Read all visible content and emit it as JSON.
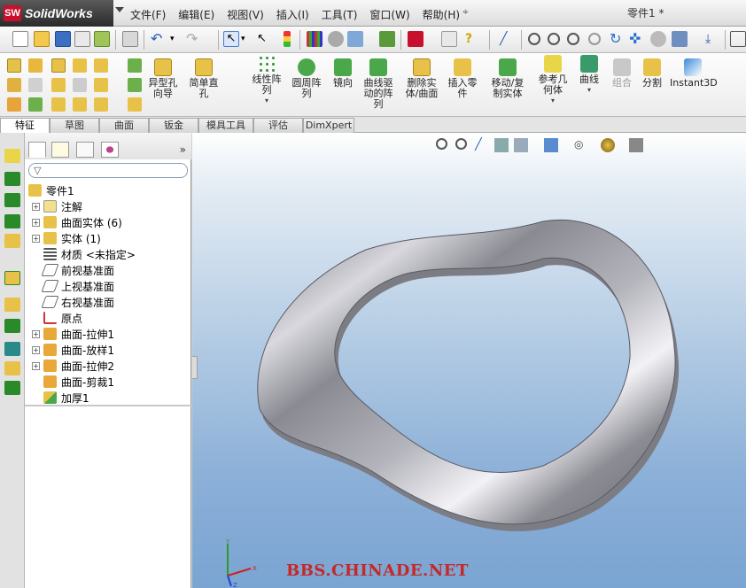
{
  "app": {
    "name": "SolidWorks",
    "logo_mark": "SW"
  },
  "menu": [
    "文件(F)",
    "编辑(E)",
    "视图(V)",
    "插入(I)",
    "工具(T)",
    "窗口(W)",
    "帮助(H)"
  ],
  "document_title": "零件1 *",
  "command_manager": {
    "commands": [
      {
        "label": "异型孔\n向导"
      },
      {
        "label": "简单直\n孔"
      },
      {
        "label": "线性阵\n列"
      },
      {
        "label": "圆周阵\n列"
      },
      {
        "label": "镜向"
      },
      {
        "label": "曲线驱\n动的阵\n列"
      },
      {
        "label": "删除实\n体/曲面"
      },
      {
        "label": "插入零\n件"
      },
      {
        "label": "移动/复\n制实体"
      },
      {
        "label": "参考几\n何体"
      },
      {
        "label": "曲线"
      },
      {
        "label": "组合"
      },
      {
        "label": "分割"
      },
      {
        "label": "Instant3D"
      }
    ]
  },
  "tabs": [
    "特征",
    "草图",
    "曲面",
    "钣金",
    "模具工具",
    "评估",
    "DimXpert"
  ],
  "feature_tree": {
    "root": "零件1",
    "items": [
      {
        "label": "注解",
        "expandable": true,
        "icon": "annotation-icon"
      },
      {
        "label": "曲面实体 (6)",
        "expandable": true,
        "icon": "surface-bodies-icon"
      },
      {
        "label": "实体 (1)",
        "expandable": true,
        "icon": "solid-bodies-icon"
      },
      {
        "label": "材质 <未指定>",
        "expandable": false,
        "icon": "material-icon"
      },
      {
        "label": "前视基准面",
        "expandable": false,
        "icon": "plane-icon"
      },
      {
        "label": "上视基准面",
        "expandable": false,
        "icon": "plane-icon"
      },
      {
        "label": "右视基准面",
        "expandable": false,
        "icon": "plane-icon"
      },
      {
        "label": "原点",
        "expandable": false,
        "icon": "origin-icon"
      },
      {
        "label": "曲面-拉伸1",
        "expandable": true,
        "icon": "surface-extrude-icon"
      },
      {
        "label": "曲面-放样1",
        "expandable": true,
        "icon": "surface-loft-icon"
      },
      {
        "label": "曲面-拉伸2",
        "expandable": true,
        "icon": "surface-extrude-icon"
      },
      {
        "label": "曲面-剪裁1",
        "expandable": false,
        "icon": "surface-trim-icon"
      },
      {
        "label": "加厚1",
        "expandable": false,
        "icon": "thicken-icon"
      }
    ]
  },
  "viewport": {
    "watermark": "BBS.CHINADE.NET",
    "triad_x": "X",
    "triad_y": "Y",
    "triad_z": "Z"
  },
  "colors": {
    "brand": "#c8102e",
    "viewport_top": "#ffffff",
    "viewport_bottom": "#7aa4d2",
    "model": "#a8a8b0"
  }
}
